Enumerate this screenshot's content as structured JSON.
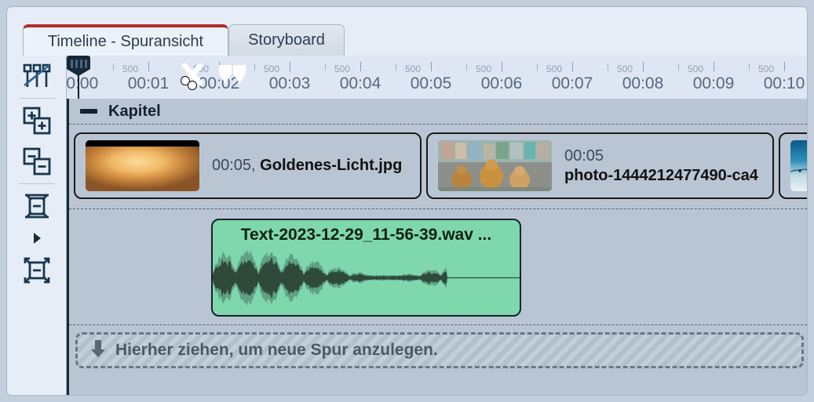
{
  "window": {
    "app_kind": "video-editor-timeline"
  },
  "tabs": [
    {
      "label": "Timeline - Spuransicht",
      "active": true
    },
    {
      "label": "Storyboard",
      "active": false
    }
  ],
  "toolbar": {
    "items": [
      {
        "name": "edit-keyframes-icon",
        "tooltip": "Keyframes"
      },
      {
        "name": "zoom-in-tracks-icon",
        "tooltip": "Spuren vergroessern"
      },
      {
        "name": "zoom-out-tracks-icon",
        "tooltip": "Spuren verkleinern"
      },
      {
        "name": "fit-height-icon",
        "tooltip": "Hoehe anpassen"
      },
      {
        "name": "expand-arrow-icon",
        "tooltip": "Mehr"
      },
      {
        "name": "fit-all-icon",
        "tooltip": "Alles anpassen"
      }
    ]
  },
  "ruler": {
    "major_labels": [
      "00:00",
      "00:01",
      "00:02",
      "00:03",
      "00:04",
      "00:05",
      "00:06",
      "00:07",
      "00:08",
      "00:09",
      "00:10"
    ],
    "minor_label": "500",
    "playhead_position": "00:00",
    "markers": [
      "in-marker",
      "out-marker"
    ],
    "scissors_tool": "scissors-icon"
  },
  "chapter": {
    "title": "Kapitel",
    "collapse_label": "collapse"
  },
  "video_track": {
    "clips": [
      {
        "duration": "00:05,",
        "name": "Goldenes-Licht.jpg",
        "single_line": true,
        "thumb": "th-golden"
      },
      {
        "duration": "00:05",
        "name": "photo-1444212477490-ca4",
        "single_line": false,
        "thumb": "th-dogs"
      },
      {
        "duration": "",
        "name": "",
        "single_line": false,
        "thumb": "th-phone"
      }
    ]
  },
  "audio_track": {
    "clip": {
      "name": "Text-2023-12-29_11-56-39.wav ...",
      "color": "#7fd8ad"
    }
  },
  "dropzone": {
    "label": "Hierher ziehen, um neue Spur anzulegen.",
    "icon": "down-arrow-icon"
  },
  "colors": {
    "accent_tab": "#b22c2c",
    "panel_bg": "#e6edf7",
    "track_bg": "#b9c5d2",
    "audio_clip": "#7fd8ad",
    "playhead": "#14293a"
  }
}
